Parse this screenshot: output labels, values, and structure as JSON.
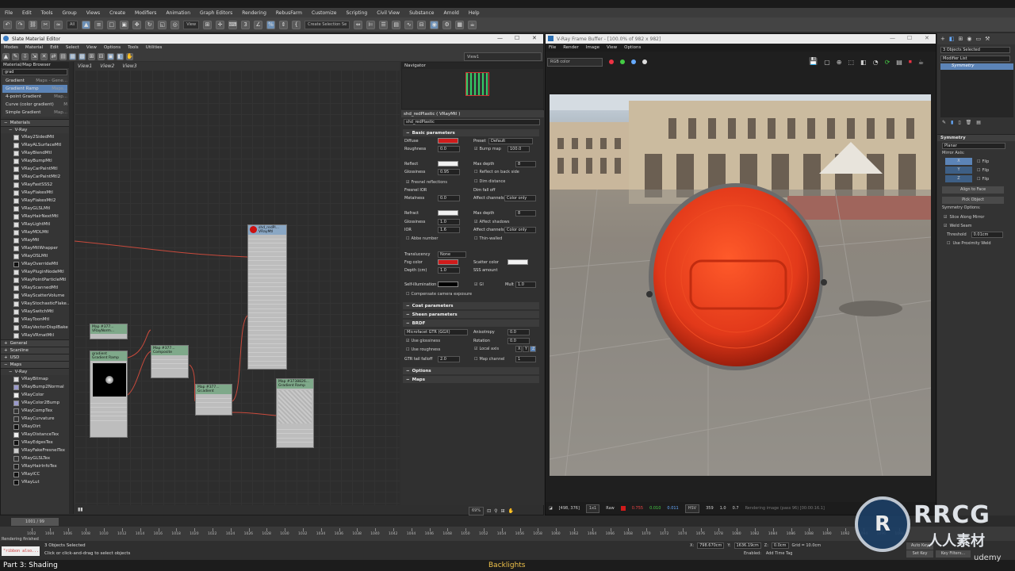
{
  "app": {
    "menu": [
      "File",
      "Edit",
      "Tools",
      "Group",
      "Views",
      "Create",
      "Modifiers",
      "Animation",
      "Graph Editors",
      "Rendering",
      "RebusFarm",
      "Customize",
      "Scripting",
      "Civil View",
      "Substance",
      "Arnold",
      "Help"
    ],
    "toolbar_dropdowns": [
      "All",
      "View",
      "Create Selection Se"
    ]
  },
  "slate": {
    "title": "Slate Material Editor",
    "menu": [
      "Modes",
      "Material",
      "Edit",
      "Select",
      "View",
      "Options",
      "Tools",
      "Utilities"
    ],
    "view_dropdown": "View1",
    "browser_title": "Material/Map Browser",
    "search_value": "grad",
    "search_results": [
      {
        "label": "Gradient",
        "tag": "Maps - Gene..."
      },
      {
        "label": "Gradient Ramp",
        "tag": "Maps..."
      },
      {
        "label": "4-point Gradient",
        "tag": "Map..."
      },
      {
        "label": "Curve (color gradient)",
        "tag": "M"
      },
      {
        "label": "Simple Gradient",
        "tag": "Map..."
      }
    ],
    "materials_header": "Materials",
    "vray_header": "V-Ray",
    "materials": [
      "VRay2SidedMtl",
      "VRayALSurfaceMtl",
      "VRayBlendMtl",
      "VRayBumpMtl",
      "VRayCarPaintMtl",
      "VRayCarPaintMtl2",
      "VRayFastSSS2",
      "VRayFlakesMtl",
      "VRayFlakesMtl2",
      "VRayGLSLMtl",
      "VRayHairNextMtl",
      "VRayLightMtl",
      "VRayMDLMtl",
      "VRayMtl",
      "VRayMtlWrapper",
      "VRayOSLMtl",
      "VRayOverrideMtl",
      "VRayPluginNodeMtl",
      "VRayPointParticleMtl",
      "VRayScannedMtl",
      "VRayScatterVolume",
      "VRayStochasticFlake...",
      "VRaySwitchMtl",
      "VRayToonMtl",
      "VRayVectorDisplBake",
      "VRayVRmatMtl"
    ],
    "groups": [
      "General",
      "Scanline",
      "USD"
    ],
    "maps_header": "Maps",
    "maps": [
      "VRayBitmap",
      "VRayBump2Normal",
      "VRayColor",
      "VRayColor2Bump",
      "VRayCompTex",
      "VRayCurvature",
      "VRayDirt",
      "VRayDistanceTex",
      "VRayEdgesTex",
      "VRayFakeFresnelTex",
      "VRayGLSLTex",
      "VRayHairInfoTex",
      "VRayICC",
      "VRayLut"
    ],
    "view_tabs": [
      "View1",
      "View2",
      "View3"
    ],
    "navigator": "Navigator",
    "zoom": "69%",
    "nodes": [
      {
        "title": "shd_redPl...",
        "sub": "VRayMtl"
      },
      {
        "title": "Map #377...",
        "sub": "VRayNorm..."
      },
      {
        "title": "gradient",
        "sub": "Gradient Ramp"
      },
      {
        "title": "Map #377...",
        "sub": "Composite"
      },
      {
        "title": "Map #377...",
        "sub": "Gr.adient"
      },
      {
        "title": "Map #3738826...",
        "sub": "Gradient Ramp"
      }
    ]
  },
  "params": {
    "header": "shd_redPlastic  ( VRayMtl )",
    "name_field": "shd_redPlastic",
    "rollouts": {
      "basic": "Basic parameters",
      "coat": "Coat parameters",
      "sheen": "Sheen parameters",
      "brdf": "BRDF",
      "options": "Options",
      "maps": "Maps"
    },
    "diffuse": "Diffuse",
    "roughness": "Roughness",
    "roughness_v": "0.0",
    "preset": "Preset",
    "preset_v": "Default",
    "bump_map": "Bump map",
    "bump_v": "100.0",
    "reflect": "Reflect",
    "glossiness": "Glossiness",
    "gloss_v": "0.95",
    "max_depth": "Max depth",
    "max_depth_v": "8",
    "reflect_back": "Reflect on back side",
    "fresnel": "Fresnel reflections",
    "dim_distance": "Dim distance",
    "fresnel_ior": "Fresnel IOR",
    "dim_falloff": "Dim fall off",
    "metalness": "Metalness",
    "metal_v": "0.0",
    "affect_channels": "Affect channels",
    "color_only": "Color only",
    "refract": "Refract",
    "r_gloss_v": "1.0",
    "ior": "IOR",
    "ior_v": "1.6",
    "abbe": "Abbe number",
    "affect_shadows": "Affect shadows",
    "thin_walled": "Thin-walled",
    "rmax_v": "8",
    "translucency": "Translucency",
    "none": "None",
    "fog_color": "Fog color",
    "scatter": "Scatter color",
    "depth": "Depth (cm)",
    "depth_v": "1.0",
    "sss": "SSS amount",
    "self_illum": "Self-illumination",
    "gi": "GI",
    "mult": "Mult",
    "mult_v": "1.0",
    "comp_exposure": "Compensate camera exposure",
    "brdf_type": "Microfacet GTR (GGX)",
    "anisotropy": "Anisotropy",
    "aniso_v": "0.0",
    "use_gloss": "Use glossiness",
    "rotation": "Rotation",
    "rot_v": "0.0",
    "use_rough": "Use roughness",
    "local_axis": "Local axis",
    "axes": [
      "X",
      "Y",
      "Z"
    ],
    "gtr": "GTR tail falloff",
    "gtr_v": "2.0",
    "map_channel": "Map channel",
    "map_v": "1"
  },
  "vfb": {
    "title": "V-Ray Frame Buffer - [100.0% of 982 x 982]",
    "menu": [
      "File",
      "Render",
      "Image",
      "View",
      "Options"
    ],
    "channel": "RGB color",
    "coords": "[498, 376]",
    "zoom": "1x1",
    "mode": "Raw",
    "rgb": [
      "0.755",
      "0.010",
      "0.011"
    ],
    "color_space": "HSV",
    "hsv": [
      "359",
      "1.0",
      "0.7"
    ],
    "render_time": "Rendering image (pass 96) [00:00:16.1] [00:..."
  },
  "cmd": {
    "objects": "3 Objects Selected",
    "modifier_list": "Modifier List",
    "stack_item": "Symmetry",
    "rollout": "Symmetry",
    "planar": "Planar",
    "mirror_axis": "Mirror Axis:",
    "axes": [
      "X",
      "Y",
      "Z"
    ],
    "flip": "Flip",
    "align": "Align to Face",
    "pick": "Pick Object",
    "options": "Symmetry Options:",
    "slice": "Slice Along Mirror",
    "weld": "Weld Seam",
    "threshold": "Threshold",
    "threshold_v": "0.01cm",
    "prox": "Use Proximity Weld"
  },
  "timeline": {
    "frame": "1001 / 99",
    "ticks": [
      "1002",
      "1004",
      "1006",
      "1008",
      "1010",
      "1012",
      "1014",
      "1016",
      "1018",
      "1020",
      "1022",
      "1024",
      "1026",
      "1028",
      "1030",
      "1032",
      "1034",
      "1036",
      "1038",
      "1040",
      "1042",
      "1044",
      "1046",
      "1048",
      "1050",
      "1052",
      "1054",
      "1056",
      "1058",
      "1060",
      "1062",
      "1064",
      "1066",
      "1068",
      "1070",
      "1072",
      "1074",
      "1076",
      "1078",
      "1080",
      "1082",
      "1084",
      "1086",
      "1088",
      "1090",
      "1092",
      "1094",
      "1096",
      "1098"
    ]
  },
  "status": {
    "rendering_finished": "Rendering finished",
    "script": "\"ribbon also...",
    "selected": "3 Objects Selected",
    "hint": "Click or click-and-drag to select objects",
    "x": "X:",
    "x_v": "798.670cm",
    "y": "Y:",
    "y_v": "1636.19cm",
    "z": "Z:",
    "z_v": "0.0cm",
    "grid": "Grid = 10.0cm",
    "enabled": "Enabled:",
    "add_time_tag": "Add Time Tag",
    "set_key": "Set Key",
    "key_filters": "Key Filters...",
    "auto_key": "Auto Key"
  },
  "caption": {
    "left": "Part 3: Shading",
    "center": "Backlights",
    "watermark": "RRCG",
    "watermark_cn": "人人素材",
    "udemy": "udemy"
  },
  "colors": {
    "accent": "#6c8fb5",
    "diffuse": "#d01b1b",
    "lamp": "#e2391a"
  }
}
